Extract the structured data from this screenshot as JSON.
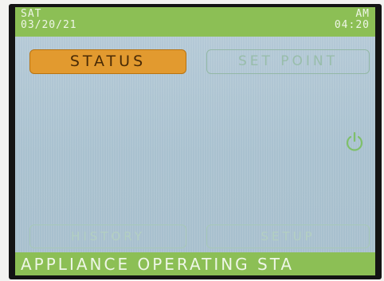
{
  "header": {
    "day": "SAT",
    "date": "03/20/21",
    "meridiem": "AM",
    "time": "04:20"
  },
  "buttons": {
    "status": "STATUS",
    "set_point": "SET POINT",
    "history": "HISTORY",
    "setup": "SETUP"
  },
  "icons": {
    "power": "power-icon"
  },
  "footer": {
    "status_text": "APPLIANCE OPERATING STA"
  },
  "colors": {
    "bar_green": "#8cbf55",
    "active_button": "#e29a2f",
    "screen_background": "#aec5d2"
  }
}
